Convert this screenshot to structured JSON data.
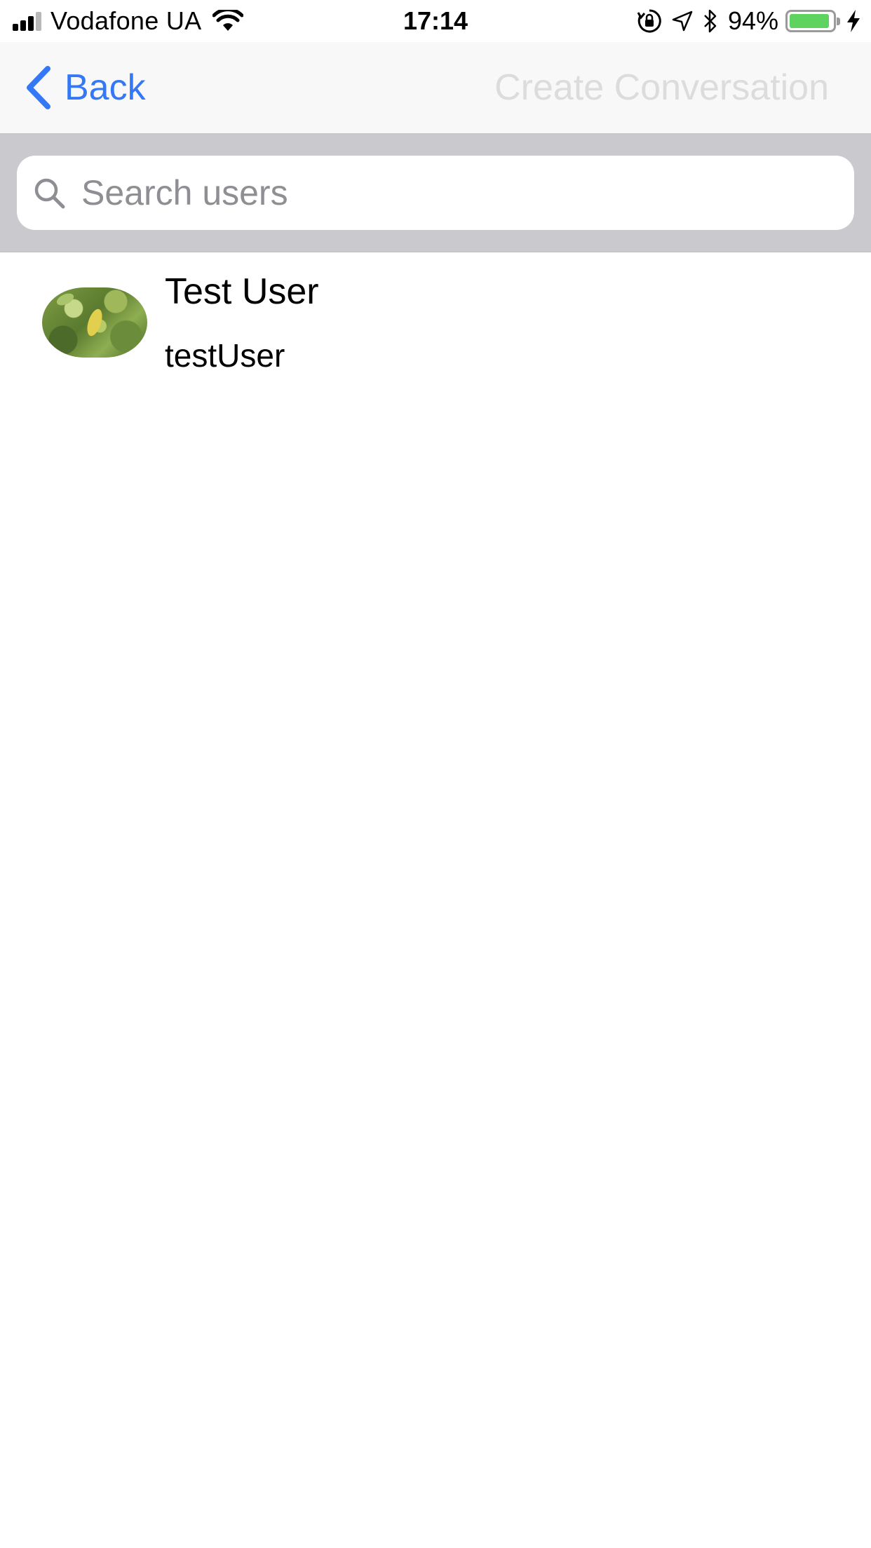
{
  "status_bar": {
    "carrier": "Vodafone UA",
    "time": "17:14",
    "battery_percent": "94%",
    "battery_level": 0.94,
    "icons": [
      "signal-icon",
      "wifi-icon",
      "orientation-lock-icon",
      "location-icon",
      "bluetooth-icon",
      "battery-icon",
      "charging-icon"
    ]
  },
  "nav": {
    "back_label": "Back",
    "action_label": "Create Conversation",
    "accent_color": "#3478f6",
    "action_disabled_color": "#dcdcdc"
  },
  "search": {
    "placeholder": "Search users",
    "value": ""
  },
  "users": [
    {
      "name": "Test User",
      "username": "testUser",
      "avatar": "plant-photo-avatar"
    }
  ]
}
